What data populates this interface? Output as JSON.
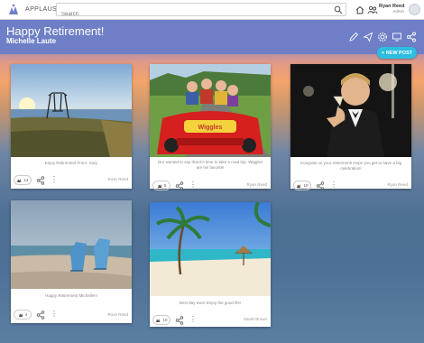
{
  "app": {
    "brand": "APPLAUSE"
  },
  "search": {
    "placeholder": "Search"
  },
  "user": {
    "name": "Ryan Reed",
    "role": "Admin"
  },
  "board": {
    "title": "Happy Retirement!",
    "recipient": "Michelle Laute"
  },
  "new_post_label": "+ NEW POST",
  "colors": {
    "header": "#6e7fc7",
    "accent": "#2dbde0"
  },
  "posts": [
    {
      "caption": "Enjoy Retirement From: Gary",
      "author": "Rose Reed",
      "applause": "14"
    },
    {
      "caption": "Our wanted to say that it's time to take a road trip. Wiggles are his favorite!",
      "author": "Ryan Reed",
      "applause": "5"
    },
    {
      "caption": "Congrats on your retirement! Hope you get to have a big celebration!",
      "author": "Ryan Reed",
      "applause": "10"
    },
    {
      "caption": "Happy Retirement Michelle!!!",
      "author": "Rose Reed",
      "applause": "4"
    },
    {
      "caption": "Best day ever! Enjoy the good life!",
      "author": "Sarah Brown",
      "applause": "10"
    }
  ]
}
